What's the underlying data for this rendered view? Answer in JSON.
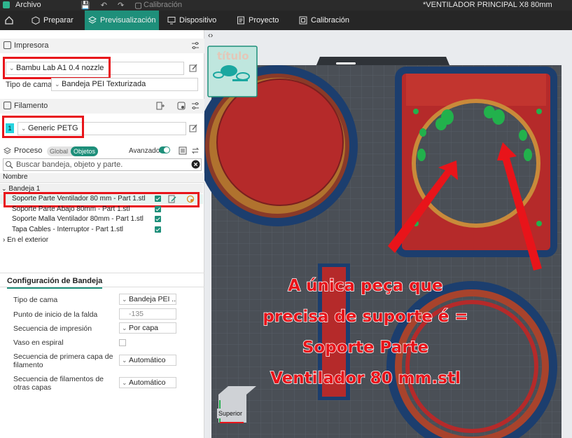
{
  "titlebar": {
    "menu": "Archivo",
    "calibration_disabled": "Calibración",
    "window_title": "*VENTILADOR PRINCIPAL X8 80mm"
  },
  "nav": {
    "tabs": [
      {
        "label": "Preparar",
        "icon": "cube-icon"
      },
      {
        "label": "Previsualización",
        "icon": "layers-icon",
        "active": true
      },
      {
        "label": "Dispositivo",
        "icon": "monitor-icon"
      },
      {
        "label": "Proyecto",
        "icon": "document-icon"
      },
      {
        "label": "Calibración",
        "icon": "calibration-icon"
      }
    ]
  },
  "printer": {
    "section_title": "Impresora",
    "name": "Bambu Lab A1 0.4 nozzle",
    "bed_type_label": "Tipo de cama",
    "bed_type": "Bandeja PEI Texturizada"
  },
  "filament": {
    "section_title": "Filamento",
    "slot": "1",
    "slot_color": "#27d3df",
    "name": "Generic PETG"
  },
  "process": {
    "section_title": "Proceso",
    "global_label": "Global",
    "objects_label": "Objetos",
    "advanced_label": "Avanzado",
    "search_placeholder": "Buscar bandeja, objeto y parte."
  },
  "tree": {
    "header": "Nombre",
    "plate": "Bandeja 1",
    "items": [
      {
        "label": "Soporte Parte Ventilador 80 mm - Part 1.stl"
      },
      {
        "label": "Soporte Parte Abajo 80mm - Part 1.stl"
      },
      {
        "label": "Soporte Malla Ventilador 80mm - Part 1.stl"
      },
      {
        "label": "Tapa Cables - Interruptor - Part 1.stl"
      }
    ],
    "outside": "En el exterior"
  },
  "plate_config": {
    "tab": "Configuración de Bandeja",
    "rows": [
      {
        "label": "Tipo de cama",
        "value": "Bandeja PEI ..."
      },
      {
        "label": "Punto de inicio de la falda",
        "value": "-135"
      },
      {
        "label": "Secuencia de impresión",
        "value": "Por capa"
      },
      {
        "label": "Vaso en espiral",
        "value": ""
      },
      {
        "label": "Secuencia de primera capa de filamento",
        "value": "Automático"
      },
      {
        "label": "Secuencia de filamentos de otras capas",
        "value": "Automático"
      }
    ]
  },
  "viewport": {
    "thumb_label": "título",
    "view_cube_label": "Superior",
    "overlay_lines": [
      "A única peça que",
      "precisa de suporte é =",
      "Soporte Parte",
      "Ventilador 80 mm.stl"
    ],
    "colors": {
      "accent": "#1e8f7a",
      "annotation_red": "#e8141a",
      "part_red": "#b52a2a",
      "bed_gray": "#4a4f56",
      "brim_blue": "#1c3e6e",
      "support_green": "#22b14c"
    }
  }
}
